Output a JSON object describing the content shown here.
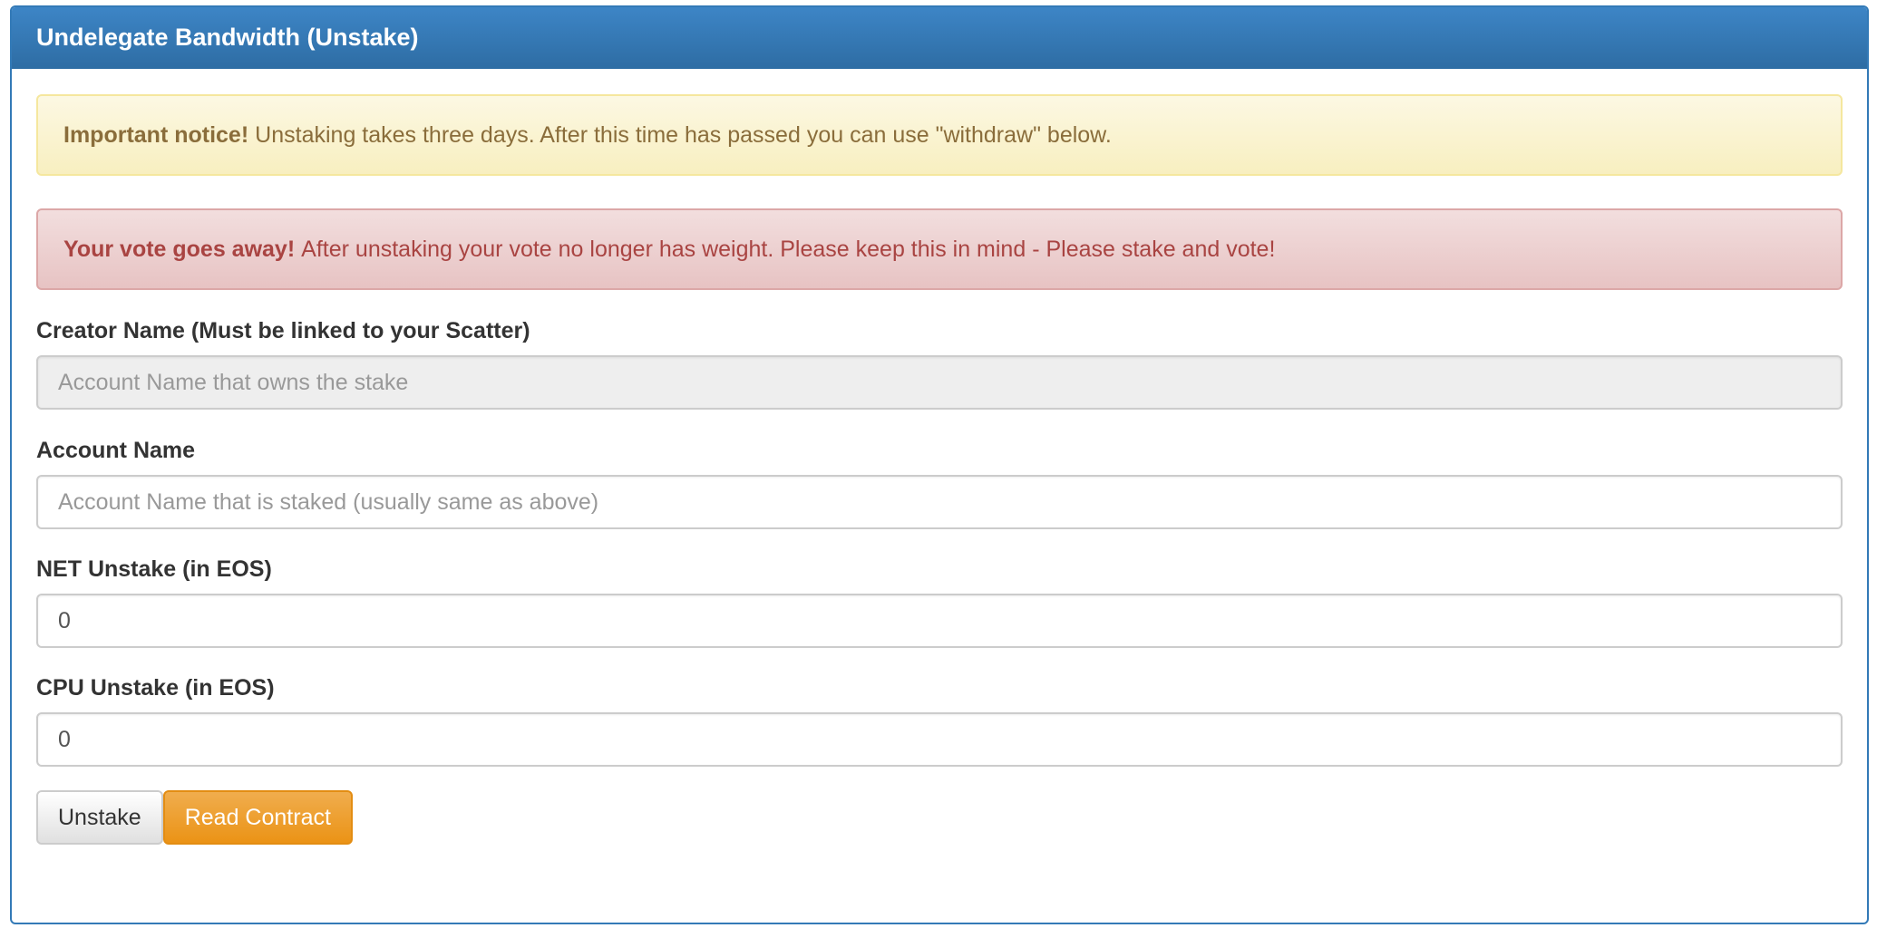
{
  "panel": {
    "title": "Undelegate Bandwidth (Unstake)"
  },
  "alerts": {
    "warning": {
      "strong": "Important notice!",
      "text": "Unstaking takes three days. After this time has passed you can use \"withdraw\" below."
    },
    "danger": {
      "strong": "Your vote goes away!",
      "text": "After unstaking your vote no longer has weight. Please keep this in mind - Please stake and vote!"
    }
  },
  "form": {
    "creator": {
      "label": "Creator Name (Must be linked to your Scatter)",
      "placeholder": "Account Name that owns the stake",
      "value": ""
    },
    "account": {
      "label": "Account Name",
      "placeholder": "Account Name that is staked (usually same as above)",
      "value": ""
    },
    "net": {
      "label": "NET Unstake (in EOS)",
      "value": "0"
    },
    "cpu": {
      "label": "CPU Unstake (in EOS)",
      "value": "0"
    }
  },
  "buttons": {
    "unstake": "Unstake",
    "read_contract": "Read Contract"
  },
  "colors": {
    "primary": "#337ab7",
    "warning": "#f0ad4e",
    "danger_text": "#a94442",
    "warning_text": "#8a6d3b"
  }
}
